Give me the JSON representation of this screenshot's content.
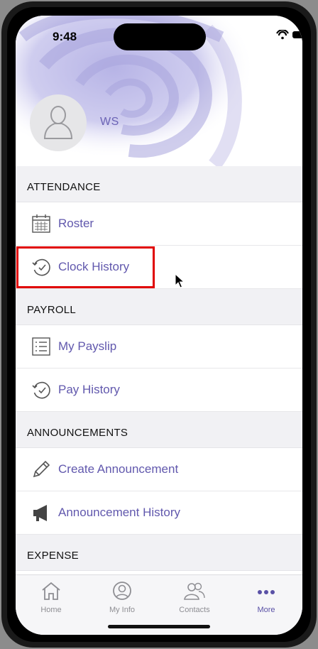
{
  "status": {
    "time": "9:48"
  },
  "profile": {
    "name": "WS"
  },
  "sections": [
    {
      "title": "ATTENDANCE",
      "items": [
        {
          "label": "Roster",
          "icon": "calendar-icon"
        },
        {
          "label": "Clock History",
          "icon": "clock-history-icon"
        }
      ]
    },
    {
      "title": "PAYROLL",
      "items": [
        {
          "label": "My Payslip",
          "icon": "payslip-list-icon"
        },
        {
          "label": "Pay History",
          "icon": "clock-history-icon"
        }
      ]
    },
    {
      "title": "ANNOUNCEMENTS",
      "items": [
        {
          "label": "Create Announcement",
          "icon": "pencil-icon"
        },
        {
          "label": "Announcement History",
          "icon": "megaphone-icon"
        }
      ]
    },
    {
      "title": "EXPENSE",
      "items": []
    }
  ],
  "tabs": [
    {
      "label": "Home",
      "icon": "home-icon"
    },
    {
      "label": "My Info",
      "icon": "person-icon"
    },
    {
      "label": "Contacts",
      "icon": "contacts-icon"
    },
    {
      "label": "More",
      "icon": "more-icon"
    }
  ],
  "colors": {
    "accent": "#6158ad",
    "highlight": "#e00000"
  }
}
